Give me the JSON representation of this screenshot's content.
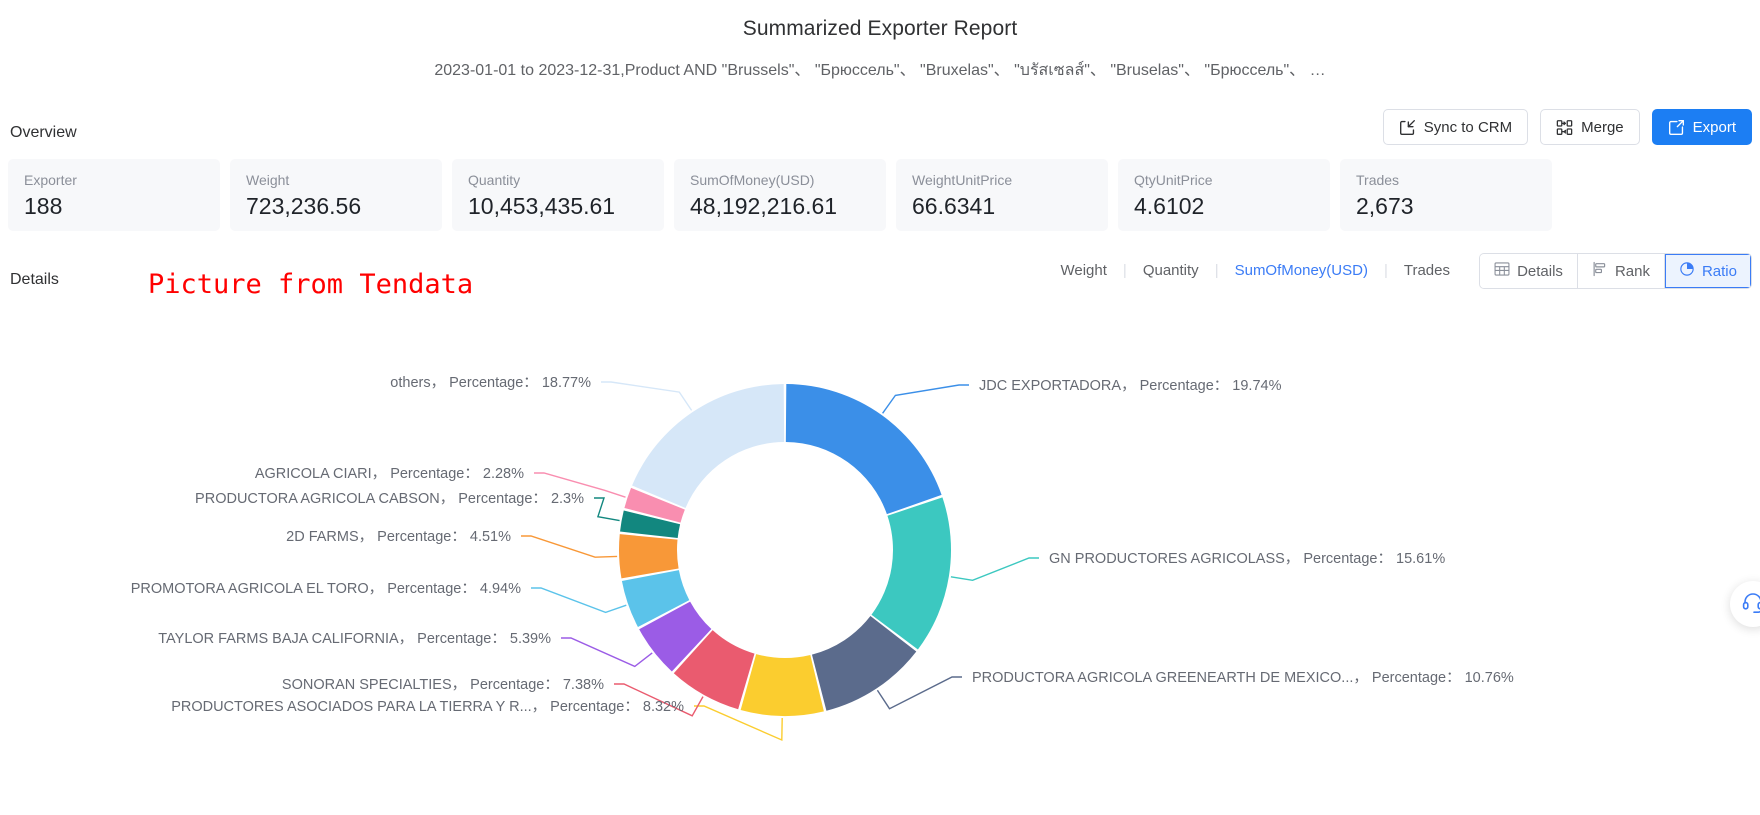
{
  "header": {
    "title": "Summarized Exporter Report",
    "subtitle": "2023-01-01 to 2023-12-31,Product AND \"Brussels\"、 \"Брюссель\"、 \"Bruxelas\"、 \"บรัสเซลส์\"、 \"Bruselas\"、 \"Брюссель\"、 …"
  },
  "overview": {
    "label": "Overview",
    "toolbar": {
      "sync_label": "Sync to CRM",
      "merge_label": "Merge",
      "export_label": "Export"
    },
    "stats": [
      {
        "label": "Exporter",
        "value": "188"
      },
      {
        "label": "Weight",
        "value": "723,236.56"
      },
      {
        "label": "Quantity",
        "value": "10,453,435.61"
      },
      {
        "label": "SumOfMoney(USD)",
        "value": "48,192,216.61"
      },
      {
        "label": "WeightUnitPrice",
        "value": "66.6341"
      },
      {
        "label": "QtyUnitPrice",
        "value": "4.6102"
      },
      {
        "label": "Trades",
        "value": "2,673"
      }
    ]
  },
  "details": {
    "label": "Details",
    "watermark": "Picture from Tendata",
    "metric_tabs": [
      {
        "label": "Weight",
        "active": false
      },
      {
        "label": "Quantity",
        "active": false
      },
      {
        "label": "SumOfMoney(USD)",
        "active": true
      },
      {
        "label": "Trades",
        "active": false
      }
    ],
    "view_buttons": [
      {
        "label": "Details",
        "icon": "table-icon",
        "active": false
      },
      {
        "label": "Rank",
        "icon": "rank-icon",
        "active": false
      },
      {
        "label": "Ratio",
        "icon": "pie-icon",
        "active": true
      }
    ]
  },
  "help": {
    "icon": "headset-icon"
  },
  "colors": {
    "accent": "#3b7cf6",
    "primary_button": "#1c7ef3",
    "card_bg": "#f7f8fa",
    "watermark": "#ff0000"
  },
  "chart_data": {
    "type": "pie",
    "title": "",
    "variant": "donut",
    "label_suffix": "Percentage：",
    "unit": "%",
    "legend": "labels-with-leader-lines",
    "categories": [
      "JDC EXPORTADORA",
      "GN PRODUCTORES AGRICOLASS",
      "PRODUCTORA AGRICOLA GREENEARTH DE MEXICO...",
      "PRODUCTORES ASOCIADOS PARA LA TIERRA Y R...",
      "SONORAN SPECIALTIES",
      "TAYLOR FARMS BAJA CALIFORNIA",
      "PROMOTORA AGRICOLA EL TORO",
      "2D FARMS",
      "PRODUCTORA AGRICOLA CABSON",
      "AGRICOLA CIARI",
      "others"
    ],
    "values": [
      19.74,
      15.61,
      10.76,
      8.32,
      7.38,
      5.39,
      4.94,
      4.51,
      2.3,
      2.28,
      18.77
    ],
    "value_labels": [
      "19.74%",
      "15.61%",
      "10.76%",
      "8.32%",
      "7.38%",
      "5.39%",
      "4.94%",
      "4.51%",
      "2.3%",
      "2.28%",
      "18.77%"
    ],
    "colors": [
      "#3b8fe8",
      "#3cc8c0",
      "#5b6b8c",
      "#fbcd2f",
      "#ea5b6f",
      "#9b5ce6",
      "#5bc3ea",
      "#f89838",
      "#12877f",
      "#f98eb0",
      "#d6e7f8"
    ],
    "labels": [
      "JDC EXPORTADORA， Percentage： 19.74%",
      "GN PRODUCTORES AGRICOLASS， Percentage： 15.61%",
      "PRODUCTORA AGRICOLA GREENEARTH DE MEXICO...， Percentage： 10.76%",
      "PRODUCTORES ASOCIADOS PARA LA TIERRA Y R...， Percentage： 8.32%",
      "SONORAN SPECIALTIES， Percentage： 7.38%",
      "TAYLOR FARMS BAJA CALIFORNIA， Percentage： 5.39%",
      "PROMOTORA AGRICOLA EL TORO， Percentage： 4.94%",
      "2D FARMS， Percentage： 4.51%",
      "PRODUCTORA AGRICOLA CABSON， Percentage： 2.3%",
      "AGRICOLA CIARI， Percentage： 2.28%",
      "others， Percentage： 18.77%"
    ]
  }
}
